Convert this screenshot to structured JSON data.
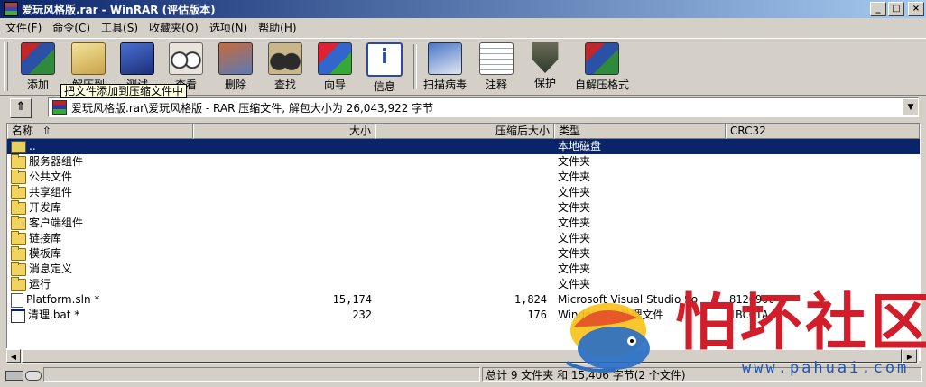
{
  "window": {
    "title": "爱玩风格版.rar - WinRAR (评估版本)",
    "controls": [
      "_",
      "□",
      "×"
    ]
  },
  "menu": [
    "文件(F)",
    "命令(C)",
    "工具(S)",
    "收藏夹(O)",
    "选项(N)",
    "帮助(H)"
  ],
  "toolbar": {
    "buttons": [
      {
        "label": "添加",
        "icon": "add-archive-icon"
      },
      {
        "label": "解压到",
        "icon": "extract-to-icon"
      },
      {
        "label": "测试",
        "icon": "test-icon"
      },
      {
        "label": "查看",
        "icon": "view-icon"
      },
      {
        "label": "删除",
        "icon": "delete-icon"
      },
      {
        "label": "查找",
        "icon": "find-icon"
      },
      {
        "label": "向导",
        "icon": "wizard-icon"
      },
      {
        "label": "信息",
        "icon": "info-icon"
      },
      {
        "label": "扫描病毒",
        "icon": "virus-scan-icon"
      },
      {
        "label": "注释",
        "icon": "comment-icon"
      },
      {
        "label": "保护",
        "icon": "protect-icon"
      },
      {
        "label": "自解压格式",
        "icon": "sfx-icon"
      }
    ],
    "tooltip": "把文件添加到压缩文件中"
  },
  "address": {
    "path": "爱玩风格版.rar\\爱玩风格版 - RAR 压缩文件, 解包大小为 26,043,922 字节"
  },
  "list": {
    "columns": {
      "name": "名称",
      "size": "大小",
      "packed": "压缩后大小",
      "type": "类型",
      "crc": "CRC32"
    },
    "rows": [
      {
        "name": "..",
        "size": "",
        "packed": "",
        "type": "本地磁盘",
        "crc": "",
        "icon": "updir",
        "selected": true
      },
      {
        "name": "服务器组件",
        "size": "",
        "packed": "",
        "type": "文件夹",
        "crc": "",
        "icon": "folder"
      },
      {
        "name": "公共文件",
        "size": "",
        "packed": "",
        "type": "文件夹",
        "crc": "",
        "icon": "folder"
      },
      {
        "name": "共享组件",
        "size": "",
        "packed": "",
        "type": "文件夹",
        "crc": "",
        "icon": "folder"
      },
      {
        "name": "开发库",
        "size": "",
        "packed": "",
        "type": "文件夹",
        "crc": "",
        "icon": "folder"
      },
      {
        "name": "客户端组件",
        "size": "",
        "packed": "",
        "type": "文件夹",
        "crc": "",
        "icon": "folder"
      },
      {
        "name": "链接库",
        "size": "",
        "packed": "",
        "type": "文件夹",
        "crc": "",
        "icon": "folder"
      },
      {
        "name": "模板库",
        "size": "",
        "packed": "",
        "type": "文件夹",
        "crc": "",
        "icon": "folder"
      },
      {
        "name": "消息定义",
        "size": "",
        "packed": "",
        "type": "文件夹",
        "crc": "",
        "icon": "folder"
      },
      {
        "name": "运行",
        "size": "",
        "packed": "",
        "type": "文件夹",
        "crc": "",
        "icon": "folder"
      },
      {
        "name": "Platform.sln *",
        "size": "15,174",
        "packed": "1,824",
        "type": "Microsoft Visual Studio So",
        "crc": "812C9004",
        "icon": "doc"
      },
      {
        "name": "清理.bat *",
        "size": "232",
        "packed": "176",
        "type": "Windows 批处理文件",
        "crc": "1BC61A",
        "icon": "bat"
      }
    ]
  },
  "status": {
    "summary": "总计 9 文件夹 和 15,406 字节(2 个文件)"
  },
  "watermark": {
    "text": "怕坏社区",
    "url": "www.pahuai.com"
  }
}
